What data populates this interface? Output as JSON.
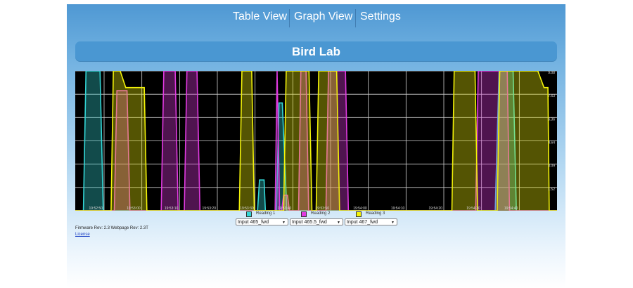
{
  "nav": {
    "items": [
      {
        "label": "Table View"
      },
      {
        "label": "Graph View"
      },
      {
        "label": "Settings"
      }
    ]
  },
  "banner": {
    "title": "Bird Lab"
  },
  "chart_data": {
    "type": "area",
    "background": "#000000",
    "grid": true,
    "x_tick_labels": [
      "19:52:50",
      "19:53:00",
      "19:53:10",
      "19:53:20",
      "19:53:30",
      "19:53:40",
      "19:53:50",
      "19:54:00",
      "19:54:10",
      "19:54:20",
      "19:54:30",
      "19:54:40"
    ],
    "y_tick_labels": [
      "9.08",
      "7.63",
      "6.36",
      "4.64",
      "3.09",
      "1.52"
    ],
    "ylim": [
      0,
      9.08
    ],
    "series": [
      {
        "name": "Reading 1",
        "color": "#33d6d6",
        "points": [
          [
            19.0,
            0
          ],
          [
            21.5,
            0
          ],
          [
            22.3,
            9.08
          ],
          [
            26.6,
            9.08
          ],
          [
            27.6,
            0
          ],
          [
            75.0,
            0
          ],
          [
            75.6,
            2.0
          ],
          [
            77.0,
            2.0
          ],
          [
            77.4,
            0
          ],
          [
            80.8,
            0
          ],
          [
            81.6,
            7.0
          ],
          [
            82.6,
            7.0
          ],
          [
            84.0,
            0
          ],
          [
            148.0,
            0
          ],
          [
            149.2,
            9.08
          ],
          [
            153.5,
            9.08
          ],
          [
            154.5,
            0
          ],
          [
            167.0,
            0
          ]
        ]
      },
      {
        "name": "Reading 2",
        "color": "#e13ae1",
        "points": [
          [
            19.0,
            0
          ],
          [
            31.0,
            0
          ],
          [
            31.8,
            7.8
          ],
          [
            34.9,
            7.8
          ],
          [
            35.8,
            0
          ],
          [
            45.4,
            0
          ],
          [
            46.2,
            9.08
          ],
          [
            49.7,
            9.08
          ],
          [
            50.6,
            0
          ],
          [
            52.5,
            0
          ],
          [
            53.3,
            9.08
          ],
          [
            56.4,
            9.08
          ],
          [
            57.3,
            0
          ],
          [
            80.4,
            0
          ],
          [
            81.0,
            9.08
          ],
          [
            81.8,
            0
          ],
          [
            82.4,
            0
          ],
          [
            83.0,
            1.0
          ],
          [
            84.2,
            1.0
          ],
          [
            84.8,
            0
          ],
          [
            87.6,
            0
          ],
          [
            88.3,
            9.08
          ],
          [
            89.9,
            9.08
          ],
          [
            90.7,
            0
          ],
          [
            96.0,
            0
          ],
          [
            96.8,
            9.08
          ],
          [
            102.0,
            9.08
          ],
          [
            102.9,
            0
          ],
          [
            142.0,
            0
          ],
          [
            142.8,
            9.08
          ],
          [
            151.7,
            9.08
          ],
          [
            152.4,
            0
          ],
          [
            167.0,
            0
          ]
        ]
      },
      {
        "name": "Reading 3",
        "color": "#f2f20a",
        "points": [
          [
            19.0,
            0
          ],
          [
            30.0,
            0
          ],
          [
            30.7,
            9.08
          ],
          [
            32.8,
            9.08
          ],
          [
            34.5,
            8.0
          ],
          [
            40.2,
            8.0
          ],
          [
            41.0,
            0
          ],
          [
            69.4,
            0
          ],
          [
            70.2,
            9.08
          ],
          [
            73.2,
            9.08
          ],
          [
            74.0,
            0
          ],
          [
            83.0,
            0
          ],
          [
            83.8,
            9.08
          ],
          [
            90.8,
            9.08
          ],
          [
            91.7,
            0
          ],
          [
            93.0,
            0
          ],
          [
            93.8,
            9.08
          ],
          [
            99.3,
            9.08
          ],
          [
            100.2,
            0
          ],
          [
            134.7,
            0
          ],
          [
            135.4,
            9.08
          ],
          [
            141.8,
            9.08
          ],
          [
            142.6,
            0
          ],
          [
            148.6,
            0
          ],
          [
            149.4,
            9.08
          ],
          [
            161.1,
            9.08
          ],
          [
            163.0,
            8.0
          ],
          [
            164.2,
            8.0
          ],
          [
            164.6,
            0
          ],
          [
            167.0,
            0
          ]
        ]
      }
    ],
    "xlim": [
      19.0,
      167.0
    ]
  },
  "legend": [
    {
      "label": "Reading 1",
      "color": "#33d6d6"
    },
    {
      "label": "Reading 2",
      "color": "#e13ae1"
    },
    {
      "label": "Reading 3",
      "color": "#f2f20a"
    }
  ],
  "selects": [
    {
      "value": "Input 465_fwd"
    },
    {
      "value": "Input 465.5_fwd"
    },
    {
      "value": "Input 467_fwd"
    }
  ],
  "footer": {
    "firmware": "Firmware Rev: 2.3 Webpage Rev: 2.3T",
    "license": "License"
  }
}
